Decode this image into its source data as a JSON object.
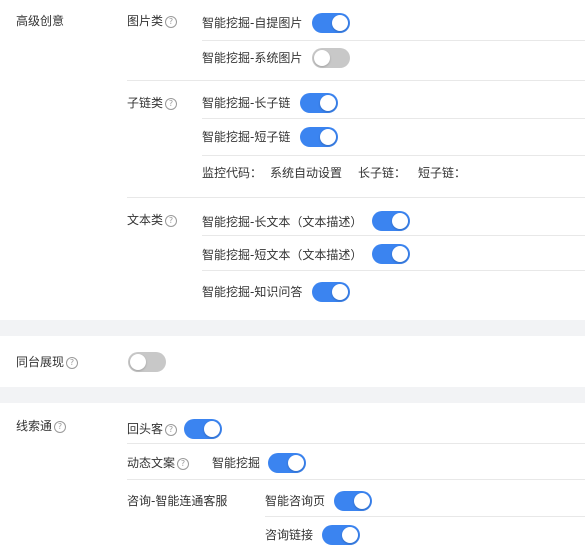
{
  "advanced": {
    "title": "高级创意",
    "image": {
      "label": "图片类",
      "items": [
        {
          "label": "智能挖掘-自提图片",
          "on": true
        },
        {
          "label": "智能挖掘-系统图片",
          "on": false
        }
      ]
    },
    "sublink": {
      "label": "子链类",
      "items": [
        {
          "label": "智能挖掘-长子链",
          "on": true
        },
        {
          "label": "智能挖掘-短子链",
          "on": true
        }
      ],
      "monitor": {
        "label": "监控代码：",
        "value": "系统自动设置",
        "long": "长子链：",
        "short": "短子链："
      }
    },
    "text": {
      "label": "文本类",
      "items": [
        {
          "label": "智能挖掘-长文本（文本描述）",
          "on": true
        },
        {
          "label": "智能挖掘-短文本（文本描述）",
          "on": true
        },
        {
          "label": "智能挖掘-知识问答",
          "on": true
        }
      ]
    }
  },
  "same_display": {
    "label": "同台展现",
    "on": false
  },
  "leads": {
    "label": "线索通",
    "returning": {
      "label": "回头客",
      "on": true
    },
    "dynamic": {
      "label": "动态文案",
      "option": "智能挖掘",
      "on": true
    },
    "consult": {
      "label": "咨询-智能连通客服",
      "options": [
        {
          "label": "智能咨询页",
          "on": true
        },
        {
          "label": "咨询链接",
          "on": true
        }
      ]
    }
  },
  "help_glyph": "?"
}
